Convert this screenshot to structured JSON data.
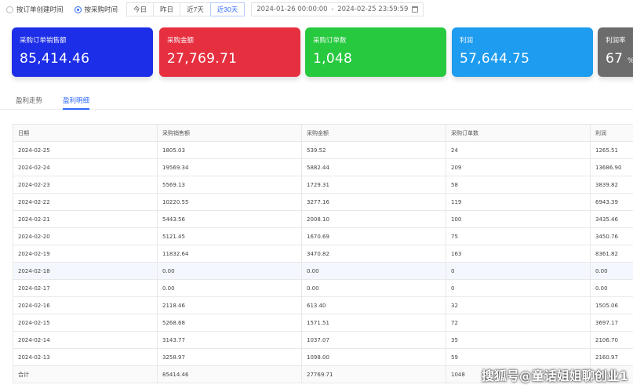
{
  "filters": {
    "radios": [
      {
        "label": "按订单创建时间",
        "checked": false
      },
      {
        "label": "按采购时间",
        "checked": true
      }
    ],
    "ranges": [
      {
        "label": "今日",
        "active": false
      },
      {
        "label": "昨日",
        "active": false
      },
      {
        "label": "近7天",
        "active": false
      },
      {
        "label": "近30天",
        "active": true
      }
    ],
    "date_start": "2024-01-26 00:00:00",
    "date_sep": "-",
    "date_end": "2024-02-25 23:59:59"
  },
  "cards": [
    {
      "label": "采购订单销售额",
      "value": "85,414.46",
      "color": "#1d2ee8"
    },
    {
      "label": "采购金额",
      "value": "27,769.71",
      "color": "#e63040"
    },
    {
      "label": "采购订单数",
      "value": "1,048",
      "color": "#27c93f"
    },
    {
      "label": "利润",
      "value": "57,644.75",
      "color": "#1d9cf0"
    },
    {
      "label": "利润率",
      "value": "67",
      "suffix": "%",
      "color": "#6c6c6c"
    }
  ],
  "tabs": [
    {
      "label": "盈利走势",
      "active": false
    },
    {
      "label": "盈利明细",
      "active": true
    }
  ],
  "table": {
    "columns": [
      "日期",
      "采购销售额",
      "采购金额",
      "采购订单数",
      "利润"
    ],
    "rows": [
      [
        "2024-02-25",
        "1805.03",
        "539.52",
        "24",
        "1265.51"
      ],
      [
        "2024-02-24",
        "19569.34",
        "5882.44",
        "209",
        "13686.90"
      ],
      [
        "2024-02-23",
        "5569.13",
        "1729.31",
        "58",
        "3839.82"
      ],
      [
        "2024-02-22",
        "10220.55",
        "3277.16",
        "119",
        "6943.39"
      ],
      [
        "2024-02-21",
        "5443.56",
        "2008.10",
        "100",
        "3435.46"
      ],
      [
        "2024-02-20",
        "5121.45",
        "1670.69",
        "75",
        "3450.76"
      ],
      [
        "2024-02-19",
        "11832.64",
        "3470.82",
        "163",
        "8361.82"
      ],
      [
        "2024-02-18",
        "0.00",
        "0.00",
        "0",
        "0.00"
      ],
      [
        "2024-02-17",
        "0.00",
        "0.00",
        "0",
        "0.00"
      ],
      [
        "2024-02-16",
        "2118.46",
        "613.40",
        "32",
        "1505.06"
      ],
      [
        "2024-02-15",
        "5268.68",
        "1571.51",
        "72",
        "3697.17"
      ],
      [
        "2024-02-14",
        "3143.77",
        "1037.07",
        "35",
        "2106.70"
      ],
      [
        "2024-02-13",
        "3258.97",
        "1098.00",
        "59",
        "2160.97"
      ]
    ],
    "highlight_row": 7,
    "footer": [
      "合计",
      "85414.46",
      "27769.71",
      "1048",
      ""
    ]
  },
  "watermark": "搜狐号@童话姐姐聊创业1"
}
